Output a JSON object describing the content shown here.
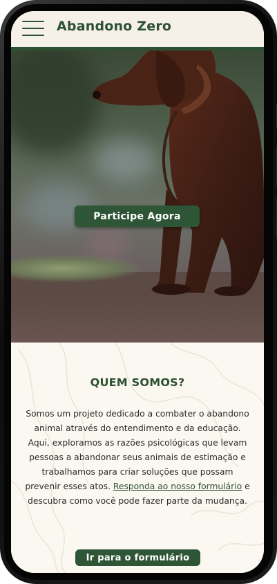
{
  "header": {
    "title": "Abandono Zero",
    "menu_icon": "hamburger-menu-icon"
  },
  "hero": {
    "image": "brown-dog-photo",
    "cta_label": "Participe Agora"
  },
  "about": {
    "heading": "QUEM SOMOS?",
    "text_before_link": "Somos um projeto dedicado a combater o abandono animal através do entendimento e da educação. Aqui, exploramos as razões psicológicas que levam pessoas a abandonar seus animais de estimação e trabalhamos para criar soluções que possam prevenir esses atos. ",
    "link_text": "Responda ao nosso formulário",
    "text_after_link": " e descubra como você pode fazer parte da mudança.",
    "button_label": "Ir para o formulário"
  },
  "colors": {
    "brand_green": "#2d5133",
    "header_bg": "#f6f1e8",
    "page_bg": "#fbf8f1",
    "button_bg": "#2f5537",
    "button_text": "#ffffff"
  }
}
